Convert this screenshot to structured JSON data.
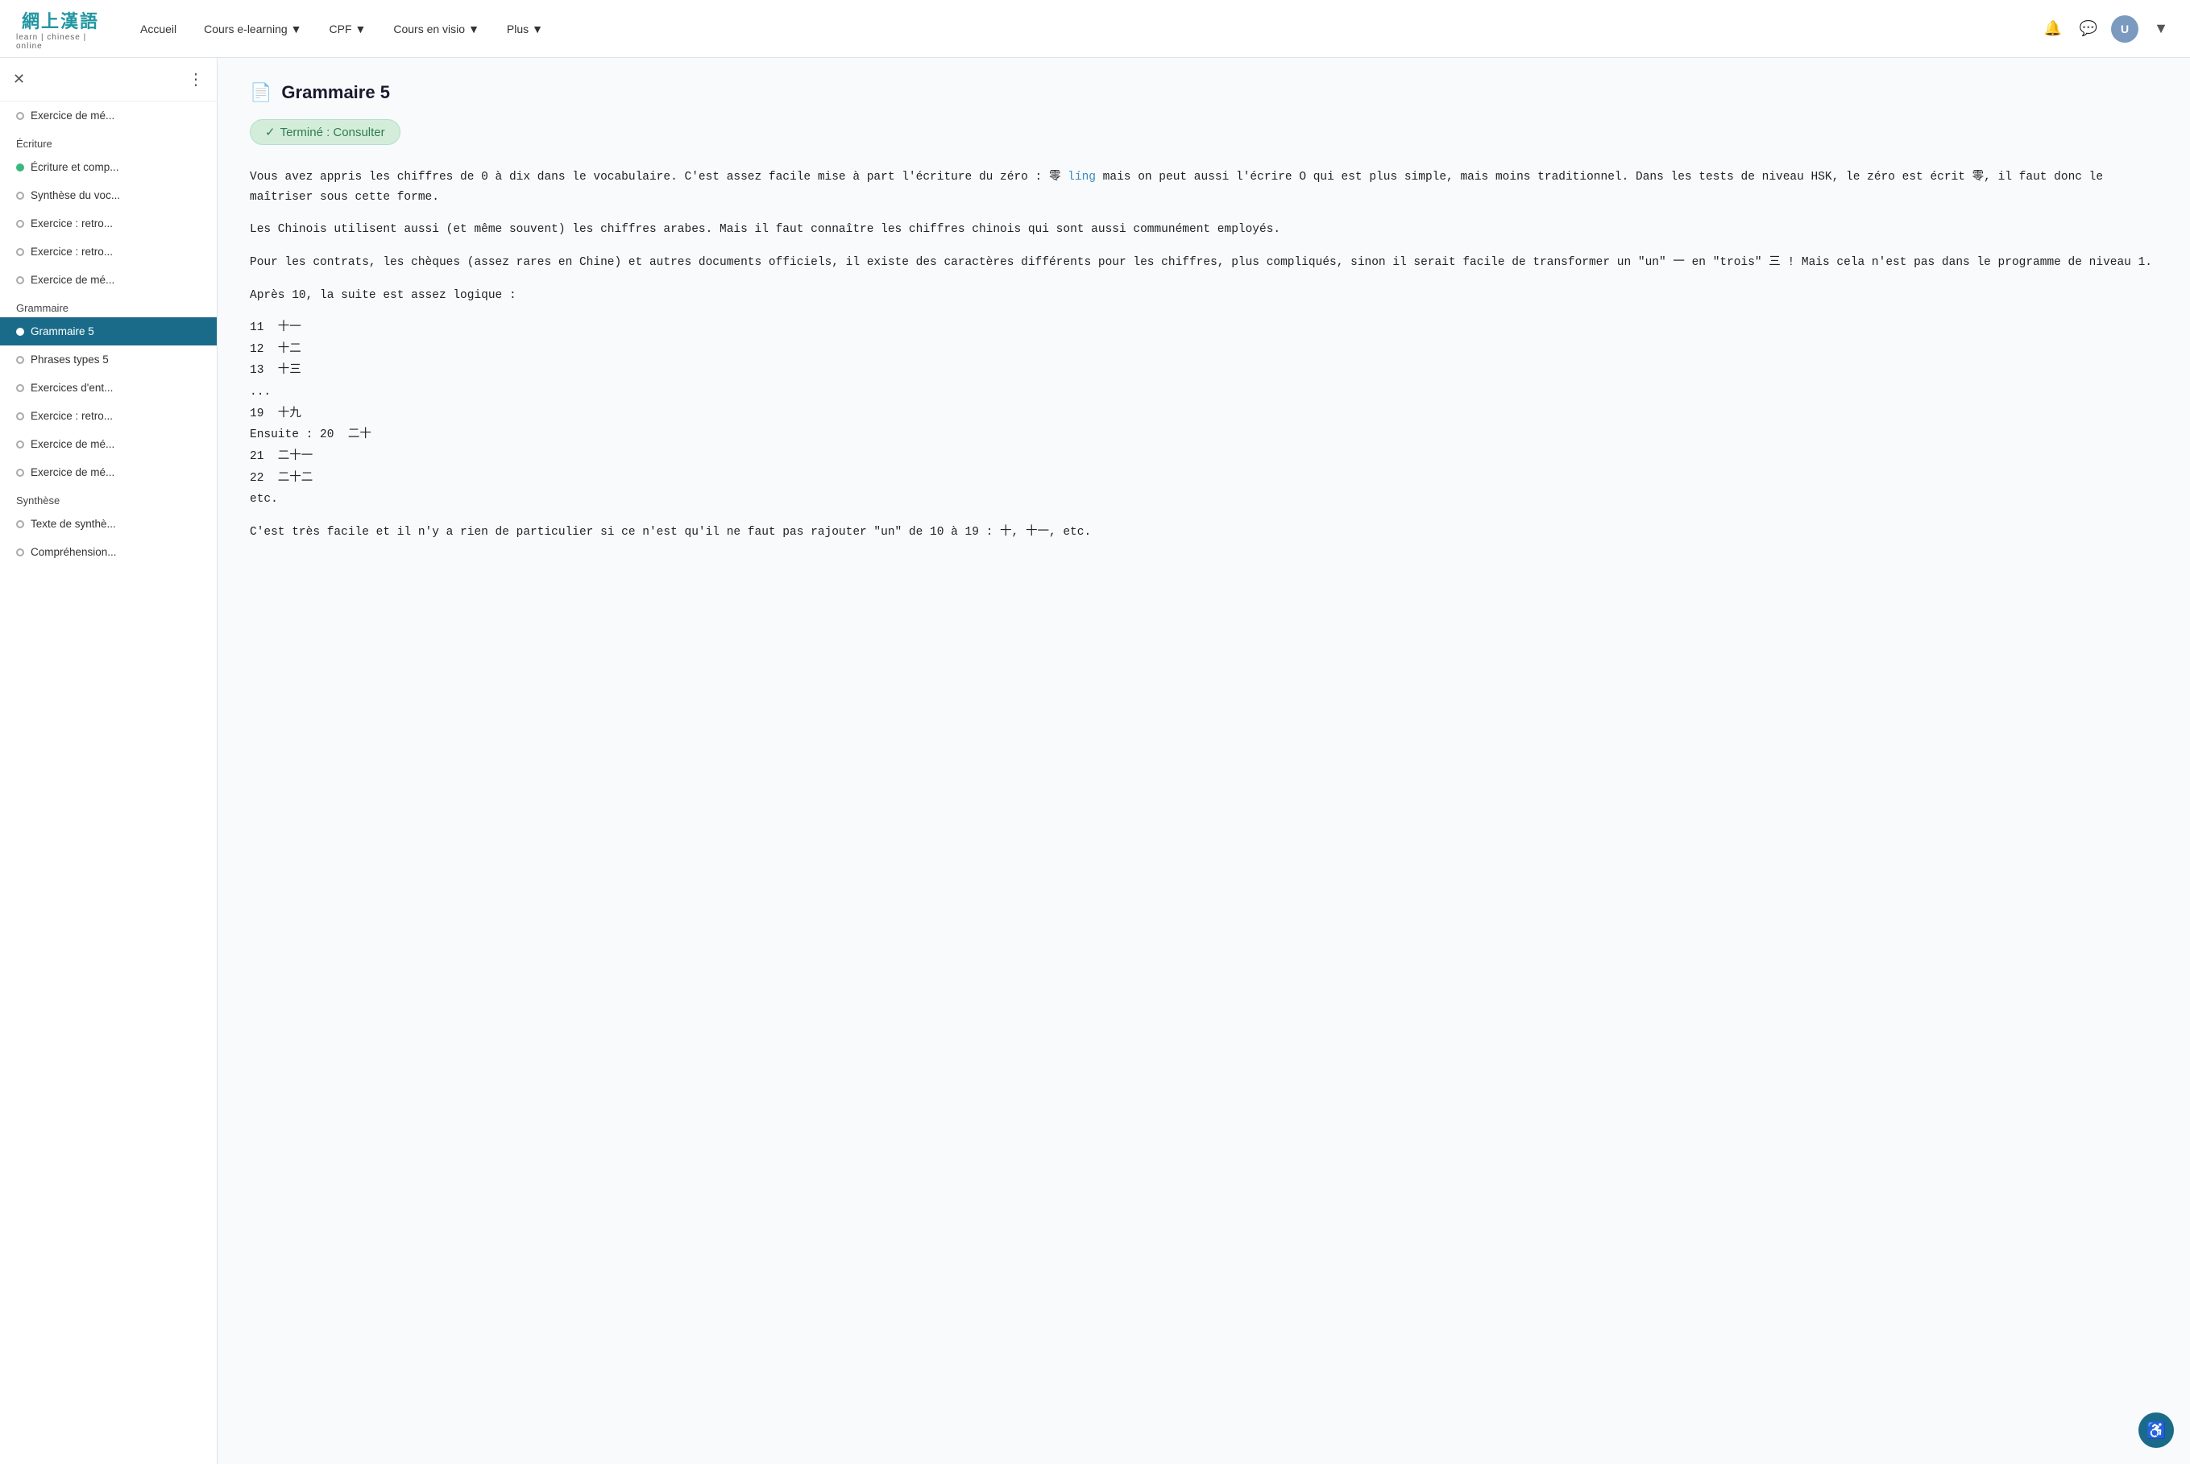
{
  "logo": {
    "chinese": "網上漢語",
    "subtitle": "learn | chinese | online"
  },
  "nav": {
    "items": [
      {
        "label": "Accueil",
        "has_dropdown": false
      },
      {
        "label": "Cours e-learning",
        "has_dropdown": true
      },
      {
        "label": "CPF",
        "has_dropdown": true
      },
      {
        "label": "Cours en visio",
        "has_dropdown": true
      },
      {
        "label": "Plus",
        "has_dropdown": true
      }
    ]
  },
  "sidebar": {
    "items": [
      {
        "label": "Exercice de mé...",
        "type": "circle",
        "active": false,
        "section": ""
      },
      {
        "label": "Écriture",
        "type": "section",
        "active": false,
        "section": "Écriture"
      },
      {
        "label": "Écriture et comp...",
        "type": "circle-green",
        "active": false,
        "section": ""
      },
      {
        "label": "Synthèse du voc...",
        "type": "circle",
        "active": false,
        "section": ""
      },
      {
        "label": "Exercice : retro...",
        "type": "circle",
        "active": false,
        "section": ""
      },
      {
        "label": "Exercice : retro...",
        "type": "circle",
        "active": false,
        "section": ""
      },
      {
        "label": "Exercice de mé...",
        "type": "circle",
        "active": false,
        "section": ""
      },
      {
        "label": "Grammaire",
        "type": "section",
        "active": false,
        "section": "Grammaire"
      },
      {
        "label": "Grammaire 5",
        "type": "circle",
        "active": true,
        "section": ""
      },
      {
        "label": "Phrases types 5",
        "type": "circle",
        "active": false,
        "section": ""
      },
      {
        "label": "Exercices d'ent...",
        "type": "circle",
        "active": false,
        "section": ""
      },
      {
        "label": "Exercice : retro...",
        "type": "circle",
        "active": false,
        "section": ""
      },
      {
        "label": "Exercice de mé...",
        "type": "circle",
        "active": false,
        "section": ""
      },
      {
        "label": "Exercice de mé...",
        "type": "circle",
        "active": false,
        "section": ""
      },
      {
        "label": "Synthèse",
        "type": "section",
        "active": false,
        "section": "Synthèse"
      },
      {
        "label": "Texte de synthè...",
        "type": "circle",
        "active": false,
        "section": ""
      },
      {
        "label": "Compréhension...",
        "type": "circle",
        "active": false,
        "section": ""
      }
    ]
  },
  "page": {
    "title": "Grammaire 5",
    "status_badge": "✓  Terminé  :  Consulter",
    "paragraphs": [
      "Vous avez appris les chiffres de 0 à dix dans le vocabulaire. C'est assez facile mise à part l'écriture du zéro : 零 líng mais on peut aussi l'écrire O qui est plus simple, mais moins traditionnel. Dans les tests de niveau HSK, le zéro est écrit 零, il faut donc le maîtriser sous cette forme.",
      "Les Chinois utilisent aussi (et même souvent) les chiffres arabes. Mais il faut connaître les chiffres chinois qui sont aussi communément employés.",
      "Pour les contrats, les chèques (assez rares en Chine) et autres documents officiels, il existe des caractères différents pour les chiffres, plus compliqués, sinon il serait facile de transformer un \"un\" 一 en \"trois\" 三 ! Mais cela n'est pas dans le programme de niveau 1.",
      "Après 10, la suite est assez logique :"
    ],
    "numbers": [
      "11  十一",
      "12  十二",
      "13  十三",
      "...",
      "19  十九",
      "Ensuite : 20  二十",
      "21  二十一",
      "22  二十二",
      "etc."
    ],
    "last_paragraph": "C'est très facile et il n'y a rien de particulier si ce n'est qu'il ne faut pas rajouter \"un\" de 10 à 19 : 十, 十一, etc."
  }
}
